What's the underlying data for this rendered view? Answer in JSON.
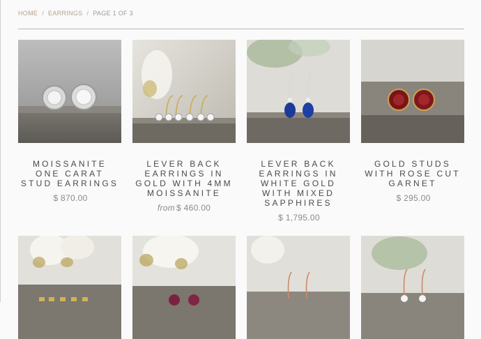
{
  "breadcrumb": {
    "home": "HOME",
    "sep": "/",
    "category": "EARRINGS",
    "page": "PAGE 1 OF 3"
  },
  "products": [
    {
      "title": "MOISSANITE ONE CARAT STUD EARRINGS",
      "price": "$ 870.00",
      "from": ""
    },
    {
      "title": "LEVER BACK EARRINGS IN GOLD WITH 4MM MOISSANITE",
      "price": "$ 460.00",
      "from": "from"
    },
    {
      "title": "LEVER BACK EARRINGS IN WHITE GOLD WITH MIXED SAPPHIRES",
      "price": "$ 1,795.00",
      "from": ""
    },
    {
      "title": "GOLD STUDS WITH ROSE CUT GARNET",
      "price": "$ 295.00",
      "from": ""
    }
  ],
  "colors": {
    "link": "#b3a28a",
    "divider": "#b5b5b5",
    "text": "#4a4a4a",
    "price": "#8a8a8a"
  }
}
